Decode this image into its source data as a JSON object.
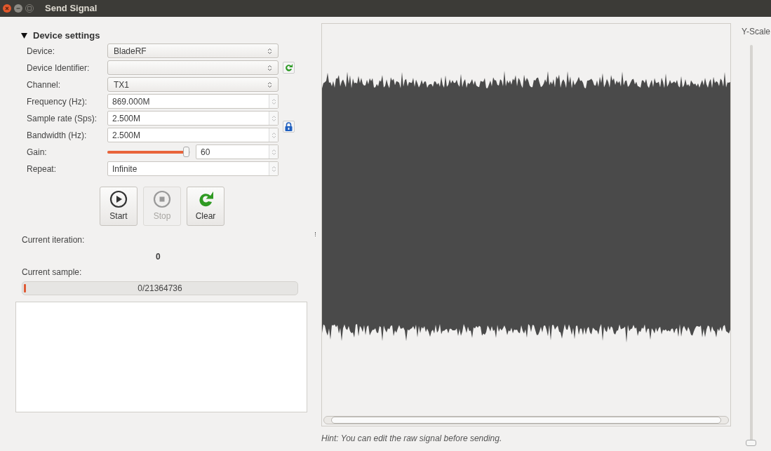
{
  "window": {
    "title": "Send Signal"
  },
  "device_settings": {
    "title": "Device settings",
    "expanded": true,
    "rows": [
      {
        "kind": "combo",
        "label": "Device:",
        "value": "BladeRF"
      },
      {
        "kind": "combo",
        "label": "Device Identifier:",
        "value": "",
        "side_button": {
          "kind": "refresh"
        }
      },
      {
        "kind": "combo",
        "label": "Channel:",
        "value": "TX1"
      },
      {
        "kind": "spin",
        "label": "Frequency (Hz):",
        "value": "869.000M"
      },
      {
        "kind": "spin",
        "label": "Sample rate (Sps):",
        "value": "2.500M",
        "side_button": {
          "kind": "lock"
        }
      },
      {
        "kind": "spin",
        "label": "Bandwidth (Hz):",
        "value": "2.500M"
      },
      {
        "kind": "gain",
        "label": "Gain:",
        "value": "60",
        "level": 0.96
      },
      {
        "kind": "spin",
        "label": "Repeat:",
        "value": "Infinite"
      }
    ]
  },
  "buttons": [
    {
      "kind": "start",
      "label": "Start",
      "disabled": false
    },
    {
      "kind": "stop",
      "label": "Stop",
      "disabled": true
    },
    {
      "kind": "clear",
      "label": "Clear",
      "disabled": false
    }
  ],
  "current_iteration": {
    "label": "Current iteration:",
    "value": "0"
  },
  "current_sample": {
    "label": "Current sample:",
    "text": "0/21364736",
    "level": 0.005
  },
  "signal_view": {
    "hint": "Hint: You can edit the raw signal before sending."
  },
  "y_scale": {
    "label": "Y-Scale",
    "level": 0
  }
}
